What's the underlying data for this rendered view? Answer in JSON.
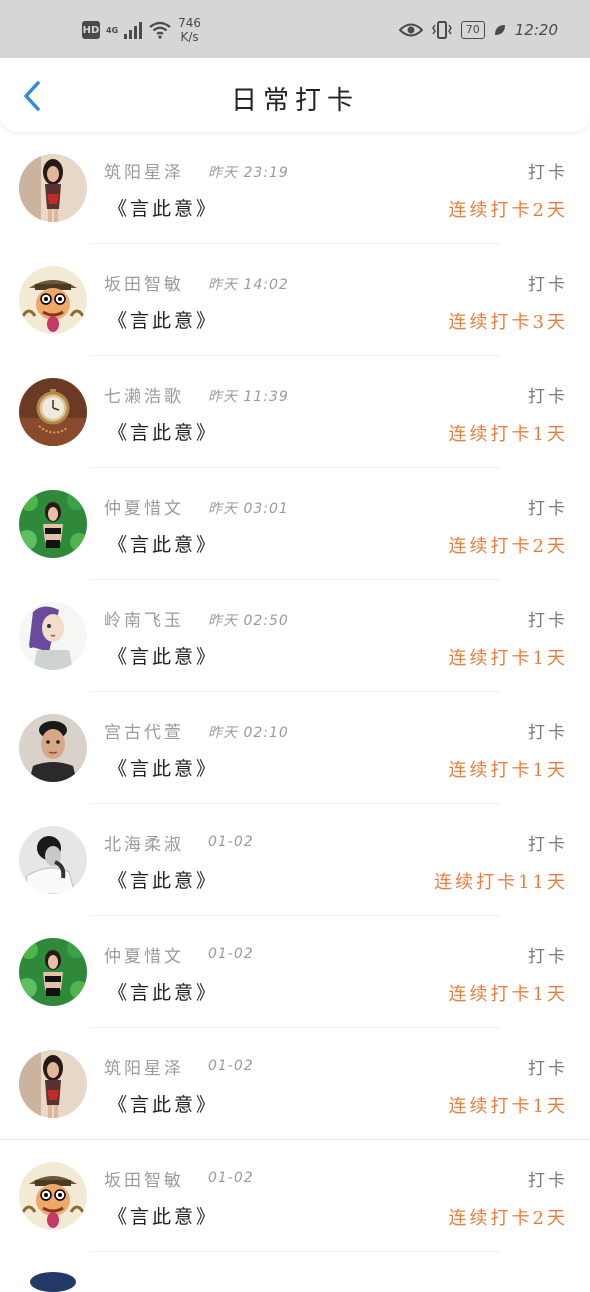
{
  "status_bar": {
    "hd": "HD",
    "network": "4G",
    "speed_value": "746",
    "speed_unit": "K/s",
    "battery": "70",
    "time": "12:20"
  },
  "header": {
    "title": "日常打卡"
  },
  "items": [
    {
      "name": "筑阳星泽",
      "time": "昨天 23:19",
      "book": "《言此意》",
      "action": "打卡",
      "streak": "连续打卡2天",
      "avatar": "photo-woman-red"
    },
    {
      "name": "坂田智敏",
      "time": "昨天 14:02",
      "book": "《言此意》",
      "action": "打卡",
      "streak": "连续打卡3天",
      "avatar": "cartoon-hat-man"
    },
    {
      "name": "七濑浩歌",
      "time": "昨天 11:39",
      "book": "《言此意》",
      "action": "打卡",
      "streak": "连续打卡1天",
      "avatar": "pocket-watch"
    },
    {
      "name": "仲夏惜文",
      "time": "昨天 03:01",
      "book": "《言此意》",
      "action": "打卡",
      "streak": "连续打卡2天",
      "avatar": "woman-green-leaves"
    },
    {
      "name": "岭南飞玉",
      "time": "昨天 02:50",
      "book": "《言此意》",
      "action": "打卡",
      "streak": "连续打卡1天",
      "avatar": "anime-purple-hair"
    },
    {
      "name": "宫古代萱",
      "time": "昨天 02:10",
      "book": "《言此意》",
      "action": "打卡",
      "streak": "连续打卡1天",
      "avatar": "young-man"
    },
    {
      "name": "北海柔淑",
      "time": "01-02",
      "book": "《言此意》",
      "action": "打卡",
      "streak": "连续打卡11天",
      "avatar": "person-bw"
    },
    {
      "name": "仲夏惜文",
      "time": "01-02",
      "book": "《言此意》",
      "action": "打卡",
      "streak": "连续打卡1天",
      "avatar": "woman-green-leaves"
    },
    {
      "name": "筑阳星泽",
      "time": "01-02",
      "book": "《言此意》",
      "action": "打卡",
      "streak": "连续打卡1天",
      "avatar": "photo-woman-red"
    },
    {
      "name": "坂田智敏",
      "time": "01-02",
      "book": "《言此意》",
      "action": "打卡",
      "streak": "连续打卡2天",
      "avatar": "cartoon-hat-man"
    }
  ],
  "colors": {
    "accent": "#2f8ae5",
    "streak": "#f07c3c",
    "status_bar_bg": "#d6d6d6"
  }
}
